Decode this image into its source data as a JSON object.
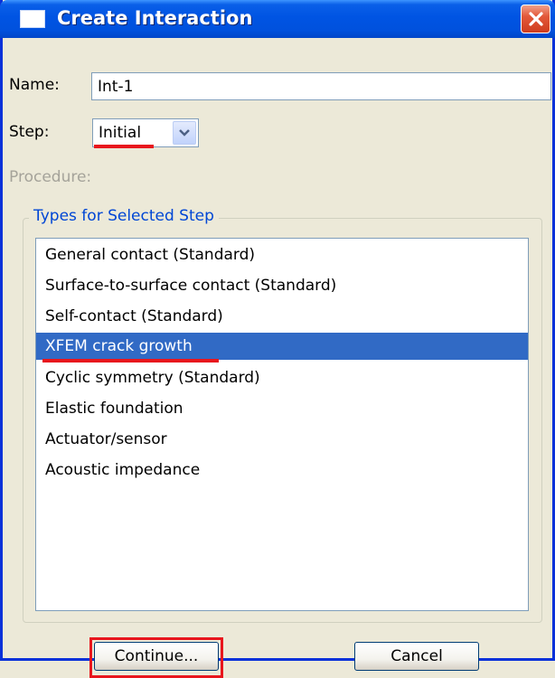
{
  "window": {
    "title": "Create Interaction"
  },
  "form": {
    "name_label": "Name:",
    "name_value": "Int-1",
    "step_label": "Step:",
    "step_value": "Initial",
    "procedure_label": "Procedure:"
  },
  "types_group": {
    "label": "Types for Selected Step",
    "items": [
      "General contact (Standard)",
      "Surface-to-surface contact (Standard)",
      "Self-contact (Standard)",
      "XFEM crack growth",
      "Cyclic symmetry (Standard)",
      "Elastic foundation",
      "Actuator/sensor",
      "Acoustic impedance"
    ],
    "selected_index": 3
  },
  "buttons": {
    "continue": "Continue...",
    "cancel": "Cancel"
  },
  "icons": {
    "window": "window-icon",
    "close": "close-icon",
    "dropdown": "chevron-down-icon"
  },
  "colors": {
    "titlebar": "#0054e3",
    "selection": "#316ac5",
    "annotation": "#e8161d",
    "group_label": "#0046d5"
  }
}
